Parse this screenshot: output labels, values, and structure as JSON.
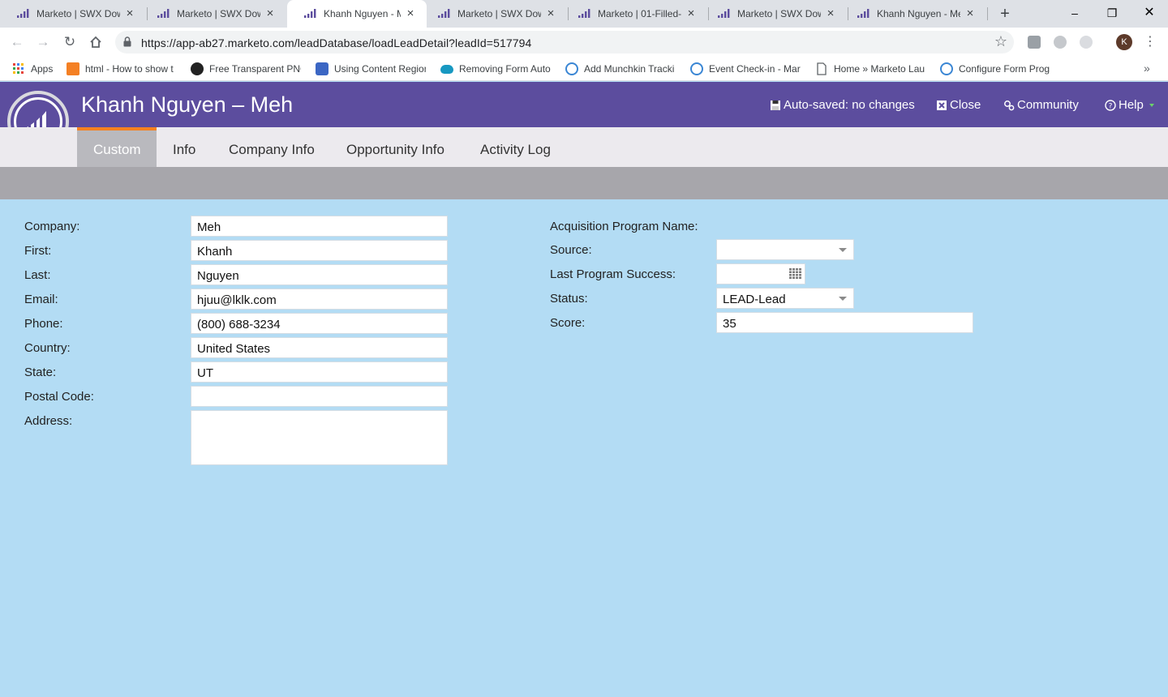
{
  "browser": {
    "tabs": [
      {
        "title": "Marketo | SWX Dow",
        "active": false
      },
      {
        "title": "Marketo | SWX Dow",
        "active": false
      },
      {
        "title": "Khanh Nguyen - Me",
        "active": true
      },
      {
        "title": "Marketo | SWX Dow",
        "active": false
      },
      {
        "title": "Marketo | 01-Filled-",
        "active": false
      },
      {
        "title": "Marketo | SWX Dow",
        "active": false
      },
      {
        "title": "Khanh Nguyen - Me",
        "active": false
      }
    ],
    "new_tab_label": "+",
    "window_controls": {
      "minimize": "–",
      "restore": "❐",
      "close": "✕"
    },
    "url": "https://app-ab27.marketo.com/leadDatabase/loadLeadDetail?leadId=517794",
    "profile_initial": "K",
    "bookmarks": [
      {
        "label": "Apps",
        "icon": "apps-grid-icon"
      },
      {
        "label": "html - How to show t",
        "icon": "stackoverflow-icon"
      },
      {
        "label": "Free Transparent PNG",
        "icon": "pngio-icon"
      },
      {
        "label": "Using Content Region",
        "icon": "p-icon"
      },
      {
        "label": "Removing Form Auto",
        "icon": "salesforce-cloud-icon"
      },
      {
        "label": "Add Munchkin Tracki",
        "icon": "marketo-circle-icon"
      },
      {
        "label": "Event Check-in - Mar",
        "icon": "marketo-circle-icon"
      },
      {
        "label": "Home » Marketo Lau",
        "icon": "page-icon"
      },
      {
        "label": "Configure Form Prog",
        "icon": "marketo-circle-icon"
      }
    ],
    "bookmarks_more": "»"
  },
  "header": {
    "title": "Khanh Nguyen – Meh",
    "autosave": "Auto-saved: no changes",
    "close": "Close",
    "community": "Community",
    "help": "Help"
  },
  "tabs": [
    "Custom",
    "Info",
    "Company Info",
    "Opportunity Info",
    "Activity Log"
  ],
  "active_tab": "Custom",
  "form_left": {
    "company": {
      "label": "Company:",
      "value": "Meh"
    },
    "first": {
      "label": "First:",
      "value": "Khanh"
    },
    "last": {
      "label": "Last:",
      "value": "Nguyen"
    },
    "email": {
      "label": "Email:",
      "value": "hjuu@lklk.com"
    },
    "phone": {
      "label": "Phone:",
      "value": "(800) 688-3234"
    },
    "country": {
      "label": "Country:",
      "value": "United States"
    },
    "state": {
      "label": "State:",
      "value": "UT"
    },
    "postal": {
      "label": "Postal Code:",
      "value": ""
    },
    "address": {
      "label": "Address:",
      "value": ""
    }
  },
  "form_right": {
    "acq_program": {
      "label": "Acquisition Program Name:",
      "value": ""
    },
    "source": {
      "label": "Source:",
      "value": ""
    },
    "last_success": {
      "label": "Last Program Success:",
      "value": ""
    },
    "status": {
      "label": "Status:",
      "value": "LEAD-Lead"
    },
    "score": {
      "label": "Score:",
      "value": "35"
    }
  },
  "colors": {
    "header_purple": "#5c4d9e",
    "tab_accent_orange": "#f58220",
    "page_background": "#b3dcf4"
  }
}
